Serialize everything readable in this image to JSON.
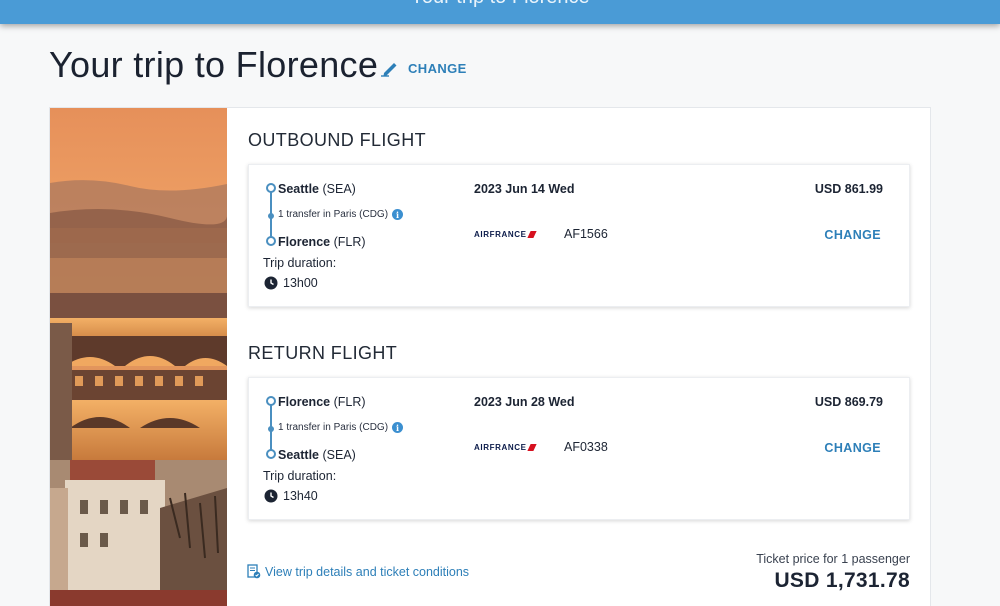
{
  "header": {
    "bar_title": "Your trip to Florence",
    "page_title": "Your trip to Florence",
    "change_label": "CHANGE"
  },
  "outbound": {
    "heading": "OUTBOUND FLIGHT",
    "origin_city": "Seattle",
    "origin_code": "(SEA)",
    "transfer": "1 transfer in Paris (CDG)",
    "dest_city": "Florence",
    "dest_code": "(FLR)",
    "duration_label": "Trip duration:",
    "duration": "13h00",
    "date": "2023 Jun 14 Wed",
    "airline": "AIRFRANCE",
    "flight_number": "AF1566",
    "price": "USD 861.99",
    "change_label": "CHANGE"
  },
  "return": {
    "heading": "RETURN FLIGHT",
    "origin_city": "Florence",
    "origin_code": "(FLR)",
    "transfer": "1 transfer in Paris (CDG)",
    "dest_city": "Seattle",
    "dest_code": "(SEA)",
    "duration_label": "Trip duration:",
    "duration": "13h40",
    "date": "2023 Jun 28 Wed",
    "airline": "AIRFRANCE",
    "flight_number": "AF0338",
    "price": "USD 869.79",
    "change_label": "CHANGE"
  },
  "footer": {
    "details_link": "View trip details and ticket conditions",
    "ticket_label": "Ticket price for 1 passenger",
    "total": "USD 1,731.78"
  },
  "colors": {
    "accent": "#2d7fb8",
    "header_bar": "#4a9bd6",
    "airline_red": "#d6101f"
  },
  "icons": [
    "pencil-icon",
    "info-icon",
    "clock-icon",
    "document-check-icon"
  ]
}
